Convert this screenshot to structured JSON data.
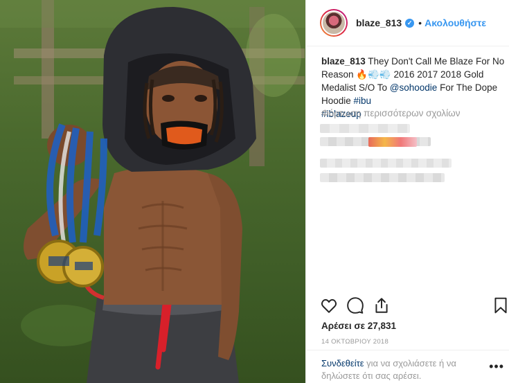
{
  "post": {
    "username": "blaze_813",
    "verified_mark": "✓",
    "separator": "•",
    "follow_label": "Ακολουθήστε"
  },
  "caption": {
    "username": "blaze_813",
    "text_1": " They Don't Call Me Blaze For No Reason ",
    "emojis": "🔥💨💨",
    "text_2": " 2016 2017 2018 Gold Medalist S/O To ",
    "mention": "@sohoodie",
    "text_3": " For The Dope Hoodie ",
    "hashtag_1": "#ibu",
    "hashtag_2": "#iblazeup"
  },
  "comments": {
    "load_more": "Φόρτωση περισσότερων σχολίων"
  },
  "stats": {
    "likes": "Αρέσει σε 27,831",
    "date": "14 ΟΚΤΩΒΡΙΟΥ 2018"
  },
  "comment_prompt": {
    "login_link": "Συνδεθείτε",
    "rest": " για να σχολιάσετε ή να δηλώσετε ότι σας αρέσει.",
    "more": "•••"
  },
  "icons": {
    "like": "heart-icon",
    "comment": "speech-bubble-icon",
    "share": "share-icon",
    "save": "bookmark-icon"
  },
  "colors": {
    "accent": "#3897f0",
    "link": "#003569",
    "muted": "#999999",
    "text": "#262626"
  }
}
